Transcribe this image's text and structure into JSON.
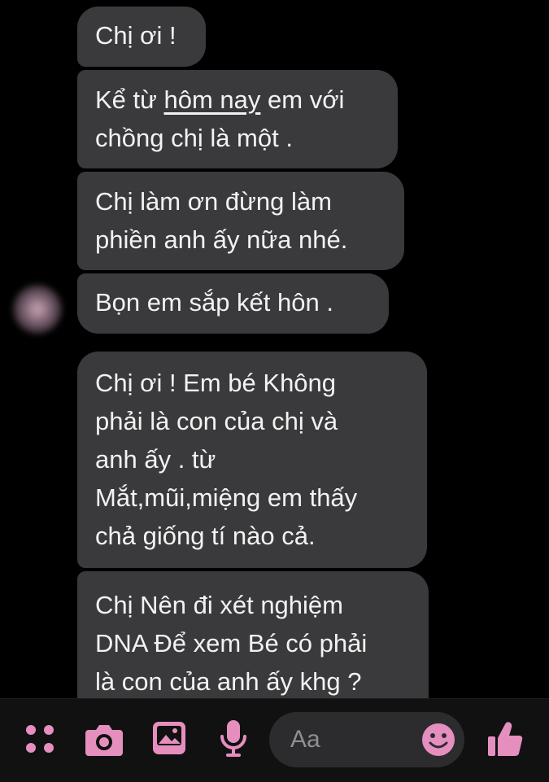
{
  "messages": [
    {
      "lines": [
        "Chị ơi !"
      ]
    },
    {
      "line1_pre": "Kể từ ",
      "line1_underlined": "hôm nay",
      "line1_post": " em với",
      "line2": "chồng chị là một ."
    },
    {
      "text": "Chị làm ơn đừng làm\nphiền anh ấy nữa nhé."
    },
    {
      "text": "Bọn em sắp kết hôn ."
    },
    {
      "text": "Chị ơi ! Em bé Không\nphải là con của chị và\nanh ấy . từ\nMắt,mũi,miệng em thấy\nchả giống tí nào cả."
    },
    {
      "text": "Chị Nên đi xét nghiệm\nDNA Để xem Bé có phải\nlà con của anh ấy khg ?"
    }
  ],
  "composer": {
    "placeholder": "Aa",
    "icons": [
      "menu-dots-icon",
      "camera-icon",
      "image-icon",
      "microphone-icon",
      "emoji-icon",
      "thumbs-up-icon"
    ]
  },
  "colors": {
    "background": "#000000",
    "bubble": "#3a3a3c",
    "text": "#f2f2f2",
    "accent": "#e58fbf"
  }
}
